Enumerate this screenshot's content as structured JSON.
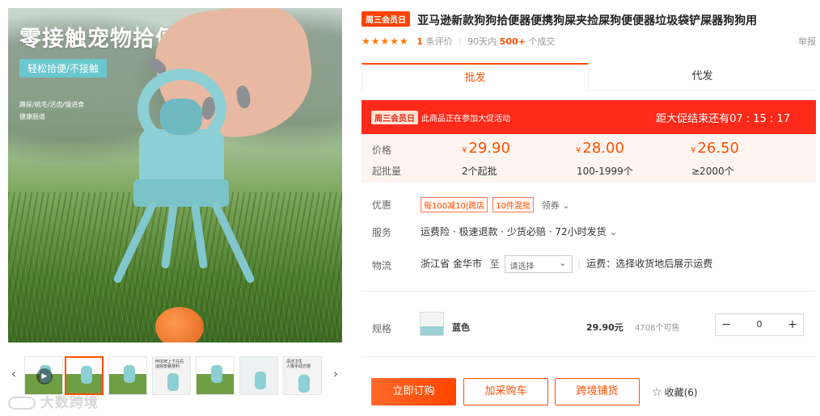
{
  "gallery": {
    "headline": "零接触宠物拾便器",
    "tag": "轻松拾便/不接触",
    "features": [
      "蹲尿/梳毛/活齿/慢进食",
      "健康肠道"
    ],
    "play_icon": "play-icon",
    "prev_icon": "chevron-left-icon",
    "next_icon": "chevron-right-icon",
    "thumbnails": [
      {
        "name": "video-thumb"
      },
      {
        "name": "thumb-1"
      },
      {
        "name": "thumb-2"
      },
      {
        "name": "thumb-3",
        "text": "MODE上下左右\n消拐安装便利"
      },
      {
        "name": "thumb-4"
      },
      {
        "name": "thumb-5"
      },
      {
        "name": "thumb-6",
        "text": "清洁卫生\n人拣手动方便"
      }
    ],
    "watermark": "大数跨境"
  },
  "product": {
    "badge": "周三会员日",
    "title": "亚马逊新款狗狗拾便器便携狗屎夹捡屎狗便便器垃圾袋铲屎器狗狗用",
    "stars": "★★★★★",
    "reviews_count": "1",
    "reviews_label": "条评价",
    "sold_prefix": "90天内",
    "sold_count": "500+",
    "sold_suffix": "个成交",
    "report": "举报"
  },
  "tabs": [
    {
      "label": "批发",
      "active": true
    },
    {
      "label": "代发",
      "active": false
    }
  ],
  "promo": {
    "badge": "周三会员日",
    "text": "此商品正在参加大促活动",
    "countdown_label": "距大促结束还有",
    "countdown": "07 : 15 : 17"
  },
  "pricing": {
    "price_label": "价格",
    "moq_label": "起批量",
    "currency": "¥",
    "tiers": [
      {
        "price": "29.90",
        "moq": "2个起批"
      },
      {
        "price": "28.00",
        "moq": "100-1999个"
      },
      {
        "price": "26.50",
        "moq": "≥2000个"
      }
    ]
  },
  "offers": {
    "label": "优惠",
    "coupons": [
      "每100减10|跨店",
      "10件混批"
    ],
    "claim": "领券"
  },
  "service": {
    "label": "服务",
    "text": "运费险 · 极速退款 · 少货必赔 · 72小时发货"
  },
  "logistics": {
    "label": "物流",
    "origin": "浙江省 金华市",
    "to": "至",
    "select_placeholder": "请选择",
    "fee": "运费：选择收货地后展示运费"
  },
  "sku": {
    "label": "规格",
    "name": "蓝色",
    "price": "29.90元",
    "stock": "4708个可售",
    "qty": "0",
    "minus": "−",
    "plus": "+"
  },
  "actions": {
    "buy": "立即订购",
    "cart": "加采购车",
    "distribute": "跨境铺货",
    "fav_label": "收藏(6)"
  },
  "colors": {
    "accent": "#ff5000",
    "promo_red": "#ff2a1a",
    "product_teal": "#8ccfd4"
  }
}
